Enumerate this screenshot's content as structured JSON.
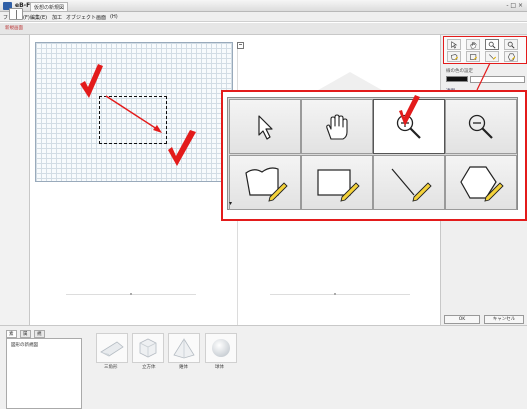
{
  "window": {
    "title": "eB-Former",
    "controls": "- □ ×"
  },
  "menu": [
    "ファイル(F)",
    "編集(E)",
    "加工",
    "オブジェクト",
    "画面",
    "(H)"
  ],
  "document_tab": "仮想の新規図",
  "left_sidebar": {
    "tag": "新規画面"
  },
  "toolbar": {
    "tools": [
      {
        "name": "select",
        "icon": "arrow-icon"
      },
      {
        "name": "pan",
        "icon": "hand-icon"
      },
      {
        "name": "zoom-in",
        "icon": "zoom-in-icon",
        "active": true
      },
      {
        "name": "zoom-out",
        "icon": "zoom-out-icon"
      },
      {
        "name": "free-shape",
        "icon": "freeform-pencil-icon"
      },
      {
        "name": "rectangle",
        "icon": "rectangle-pencil-icon"
      },
      {
        "name": "line",
        "icon": "line-pencil-icon"
      },
      {
        "name": "polygon",
        "icon": "hexagon-pencil-icon"
      }
    ]
  },
  "properties": {
    "label": "線の色の設定",
    "link": "透明",
    "ok": "OK",
    "cancel": "キャンセル"
  },
  "bottom": {
    "tabs": [
      "素材",
      "属性",
      "規格図"
    ],
    "tree_item": "図形の新規図",
    "shapes": [
      {
        "label": "三角形",
        "icon": "wedge-icon"
      },
      {
        "label": "立方体",
        "icon": "cube-icon"
      },
      {
        "label": "錐体",
        "icon": "pyramid-icon"
      },
      {
        "label": "球体",
        "icon": "sphere-icon"
      }
    ]
  },
  "colors": {
    "annotation_red": "#e31b1b",
    "grid": "#d3dde5"
  }
}
